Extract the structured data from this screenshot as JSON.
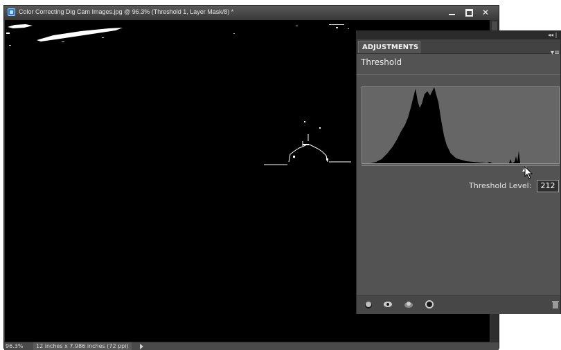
{
  "window": {
    "title": "Color Correcting Dig Cam Images.jpg @ 96.3% (Threshold 1, Layer Mask/8) *"
  },
  "status": {
    "zoom": "96.3%",
    "doc_size": "12 inches x 7.986 inches (72 ppi)"
  },
  "panel": {
    "tab_label": "ADJUSTMENTS",
    "collapse_glyph": "◂◂ |",
    "menu_glyph": "▾≡",
    "heading": "Threshold",
    "threshold_label": "Threshold Level:",
    "threshold_value": "212"
  },
  "icons": {
    "app": "photoshop-app-icon",
    "footer": [
      "clip-layer-icon",
      "visibility-eye-icon",
      "view-previous-icon",
      "reset-icon",
      "trash-icon"
    ]
  },
  "colors": {
    "panel_bg": "#535353",
    "canvas_bg": "#000000",
    "histogram_bg": "#666666"
  }
}
